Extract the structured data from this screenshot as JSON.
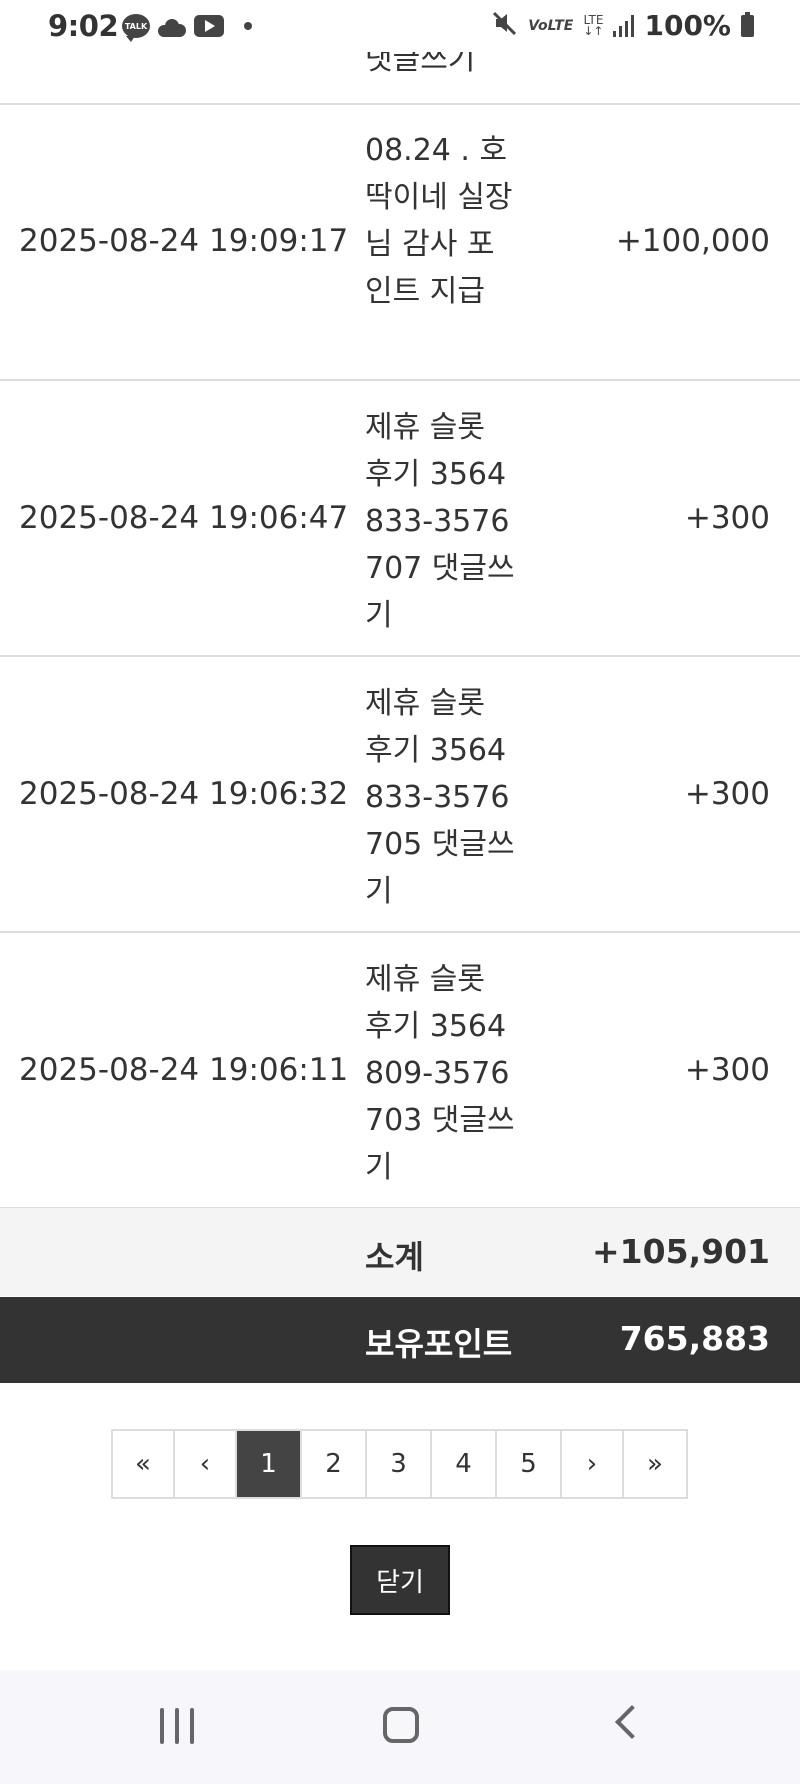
{
  "status_bar": {
    "time": "9:02",
    "talk_badge": "TALK",
    "volte": "VoLTE",
    "lte_top": "LTE",
    "lte_bottom": "↓↑",
    "battery": "100%",
    "icons": [
      "kakaotalk-icon",
      "cloud-icon",
      "youtube-icon",
      "dot-icon",
      "mute-icon",
      "volte-icon",
      "lte-icon",
      "signal-icon",
      "battery-icon"
    ]
  },
  "table": {
    "partial_top_desc": "댓글쓰기",
    "rows": [
      {
        "date": "2025-08-24 19:09:17",
        "desc": "08.24 . 호딱이네 실장님 감사 포인트 지급",
        "amount": "+100,000"
      },
      {
        "date": "2025-08-24 19:06:47",
        "desc": "제휴 슬롯 후기 3564833-3576707 댓글쓰기",
        "amount": "+300"
      },
      {
        "date": "2025-08-24 19:06:32",
        "desc": "제휴 슬롯 후기 3564833-3576705 댓글쓰기",
        "amount": "+300"
      },
      {
        "date": "2025-08-24 19:06:11",
        "desc": "제휴 슬롯 후기 3564809-3576703 댓글쓰기",
        "amount": "+300"
      }
    ],
    "subtotal_label": "소계",
    "subtotal_value": "+105,901",
    "total_label": "보유포인트",
    "total_value": "765,883"
  },
  "pagination": {
    "first": "«",
    "prev": "‹",
    "pages": [
      "1",
      "2",
      "3",
      "4",
      "5"
    ],
    "current": "1",
    "next": "›",
    "last": "»"
  },
  "close_button": "닫기",
  "colors": {
    "dark": "#333333",
    "active_page": "#444444",
    "subtotal_bg": "#f4f4f4",
    "border": "#dcdcdc"
  }
}
